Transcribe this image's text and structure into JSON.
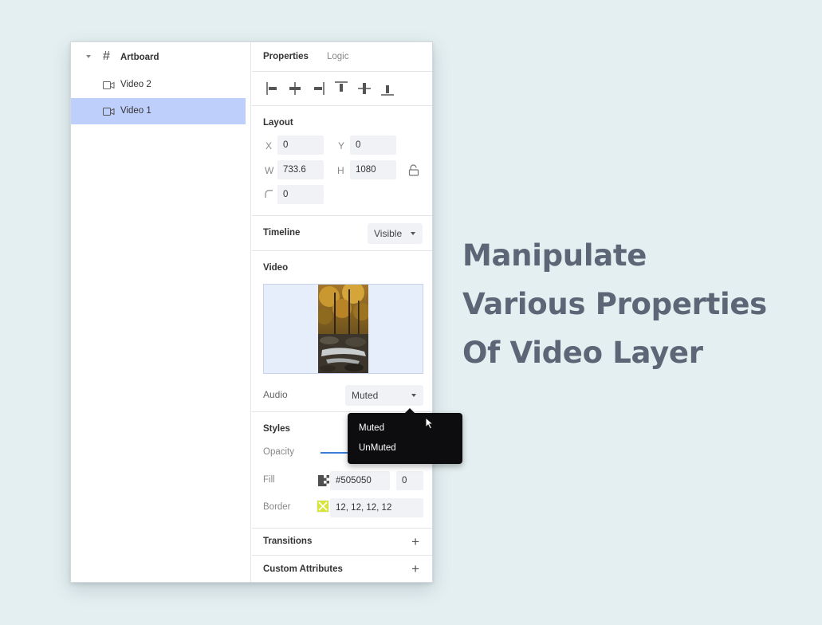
{
  "layers": {
    "artboard": "Artboard",
    "items": [
      "Video 2",
      "Video 1"
    ]
  },
  "tabs": {
    "properties": "Properties",
    "logic": "Logic"
  },
  "layout": {
    "title": "Layout",
    "x_label": "X",
    "x_value": "0",
    "y_label": "Y",
    "y_value": "0",
    "w_label": "W",
    "w_value": "733.6",
    "h_label": "H",
    "h_value": "1080",
    "radius_value": "0"
  },
  "timeline": {
    "title": "Timeline",
    "value": "Visible"
  },
  "video": {
    "title": "Video",
    "audio_label": "Audio",
    "audio_value": "Muted"
  },
  "styles": {
    "title": "Styles",
    "opacity_label": "Opacity",
    "fill_label": "Fill",
    "fill_value": "#505050",
    "fill_opacity": "0",
    "border_label": "Border",
    "border_value": "12, 12, 12, 12"
  },
  "transitions": {
    "title": "Transitions"
  },
  "custom_attributes": {
    "title": "Custom Attributes"
  },
  "audio_menu": {
    "options": [
      "Muted",
      "UnMuted"
    ]
  },
  "headline": {
    "line1": "Manipulate",
    "line2": "Various Properties",
    "line3": "Of Video Layer"
  },
  "colors": {
    "selection": "#bfcffb",
    "background": "#e4eff1",
    "headline": "#5c6676",
    "accent": "#3a7bdc"
  }
}
